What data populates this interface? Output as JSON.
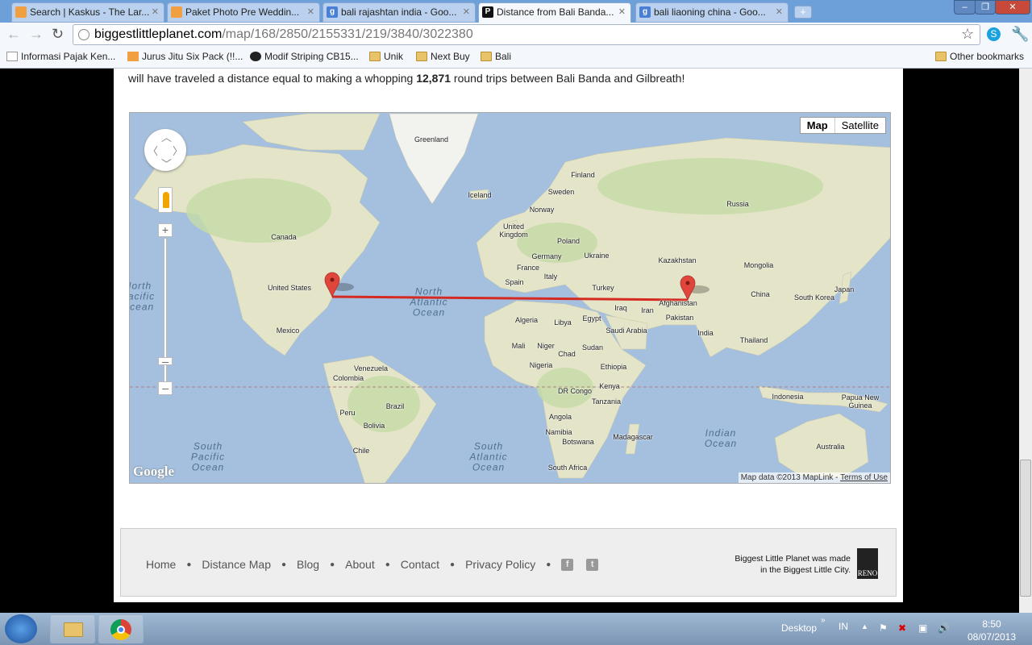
{
  "browser": {
    "tabs": [
      {
        "label": "Search | Kaskus - The Lar...",
        "icon": "kaskus-icon"
      },
      {
        "label": "Paket Photo Pre Weddin...",
        "icon": "kaskus-icon"
      },
      {
        "label": "bali rajashtan india - Goo...",
        "icon": "google-icon"
      },
      {
        "label": "Distance from Bali Banda...",
        "icon": "p-icon",
        "active": true
      },
      {
        "label": "bali liaoning china - Goo...",
        "icon": "google-icon"
      }
    ],
    "url_domain": "biggestlittleplanet.com",
    "url_path": "/map/168/2850/2155331/219/3840/3022380",
    "bookmarks": [
      "Informasi Pajak Ken...",
      "Jurus Jitu Six Pack (!!...",
      "Modif Striping CB15...",
      "Unik",
      "Next Buy",
      "Bali"
    ],
    "other_bookmarks": "Other bookmarks"
  },
  "intro": {
    "pre": "will have traveled a distance equal to making a whopping ",
    "count": "12,871",
    "post": " round trips between Bali Banda and Gilbreath!"
  },
  "map": {
    "type_buttons": [
      "Map",
      "Satellite"
    ],
    "selected_type": "Map",
    "labels": [
      "Greenland",
      "Finland",
      "Iceland",
      "Sweden",
      "Russia",
      "Norway",
      "United Kingdom",
      "Poland",
      "Canada",
      "Germany",
      "Ukraine",
      "Kazakhstan",
      "France",
      "Mongolia",
      "Italy",
      "Spain",
      "Turkey",
      "United States",
      "China",
      "Japan",
      "South Korea",
      "Afghanistan",
      "Iraq",
      "Iran",
      "Pakistan",
      "Algeria",
      "Libya",
      "Egypt",
      "Saudi Arabia",
      "Mexico",
      "India",
      "Thailand",
      "Mali",
      "Niger",
      "Sudan",
      "Chad",
      "Venezuela",
      "Nigeria",
      "Ethiopia",
      "Colombia",
      "Kenya",
      "DR Congo",
      "Indonesia",
      "Papua New Guinea",
      "Tanzania",
      "Brazil",
      "Peru",
      "Angola",
      "Bolivia",
      "Namibia",
      "Botswana",
      "Madagascar",
      "Chile",
      "South Africa",
      "Australia"
    ],
    "oceans": [
      "North Atlantic Ocean",
      "North Pacific Ocean",
      "South Pacific Ocean",
      "South Atlantic Ocean",
      "Indian Ocean"
    ],
    "logo": "Google",
    "attribution": "Map data ©2013 MapLink - ",
    "terms": "Terms of Use",
    "route_color": "#d42a22",
    "marker_color": "#e0453a"
  },
  "footer": {
    "nav": [
      "Home",
      "Distance Map",
      "Blog",
      "About",
      "Contact",
      "Privacy Policy"
    ],
    "social": [
      "facebook-icon",
      "twitter-icon"
    ],
    "made_line1": "Biggest Little Planet was made",
    "made_line2": "in the Biggest Little City.",
    "reno_logo": "RENO"
  },
  "taskbar": {
    "desktop": "Desktop",
    "lang": "IN",
    "time": "8:50",
    "date": "08/07/2013"
  }
}
